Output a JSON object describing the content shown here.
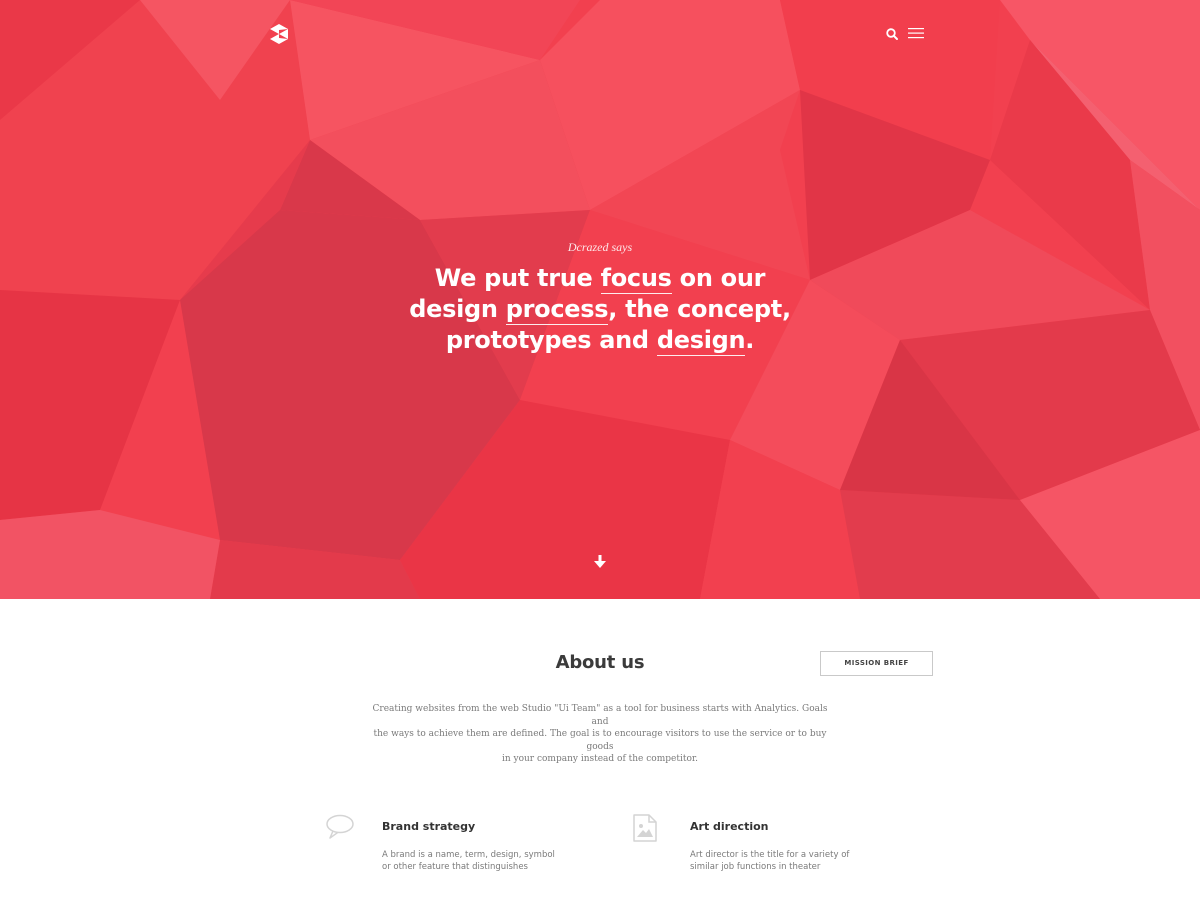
{
  "header": {
    "logo_icon": "cube-logo-icon",
    "search_icon": "search-icon",
    "menu_icon": "hamburger-menu-icon"
  },
  "hero": {
    "eyebrow": "Dcrazed says",
    "headline": {
      "line1_a": "We put true ",
      "line1_hl": "focus",
      "line1_b": " on our",
      "line2_a": "design ",
      "line2_hl": "process",
      "line2_b": ", the concept,",
      "line3_a": "prototypes and ",
      "line3_hl": "design",
      "line3_b": "."
    },
    "scroll_icon": "arrow-down-icon",
    "bg_color": "#f2404f"
  },
  "about": {
    "title": "About us",
    "mission_button": "MISSION BRIEF",
    "text_line1": "Creating websites from the web Studio \"Ui Team\" as a tool for business starts with Analytics. Goals and",
    "text_line2": "the ways to achieve them are defined. The goal is to encourage visitors to use the service or to buy goods",
    "text_line3": "in your company instead of the competitor."
  },
  "features": [
    {
      "icon": "speech-bubble-icon",
      "title": "Brand strategy",
      "desc_line1": "A brand is a name, term, design, symbol",
      "desc_line2": "or other feature that distinguishes"
    },
    {
      "icon": "image-file-icon",
      "title": "Art direction",
      "desc_line1": "Art director is the title for a variety of",
      "desc_line2": "similar job functions in theater"
    }
  ]
}
